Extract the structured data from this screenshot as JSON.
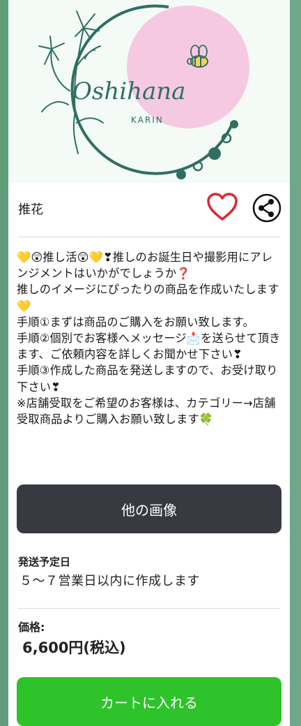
{
  "hero": {
    "logo_text": "Oshihana",
    "logo_subtext": "KARIN",
    "icon": "lily-bee-logo"
  },
  "product": {
    "title": "推花",
    "favorite_icon": "heart-outline-icon",
    "share_icon": "share-icon"
  },
  "description": "💛😲推し活😲💛❣推しのお誕生日や撮影用にアレンジメントはいかがでしょうか❓\n推しのイメージにぴったりの商品を作成いたします💛\n手順①まずは商品のご購入をお願い致します。\n手順②個別でお客様へメッセージ📩を送らせて頂きます、ご依頼内容を詳しくお聞かせ下さい❣\n手順③作成した商品を発送しますので、お受け取り下さい❣\n※店舗受取をご希望のお客様は、カテゴリー→店舗受取商品よりご購入お願い致します🍀",
  "buttons": {
    "other_images": "他の画像",
    "add_to_cart": "カートに入れる"
  },
  "shipping": {
    "label": "発送予定日",
    "value": "５～７営業日以内に作成します"
  },
  "price": {
    "label": "価格:",
    "value": "6,600円(税込)"
  },
  "colors": {
    "background": "#6fa98a",
    "brand_pink": "#f6c9e2",
    "brand_teal": "#2f6f63",
    "dark_button": "#373a40",
    "cart_button": "#2ec22b",
    "heart": "#e0252d"
  }
}
